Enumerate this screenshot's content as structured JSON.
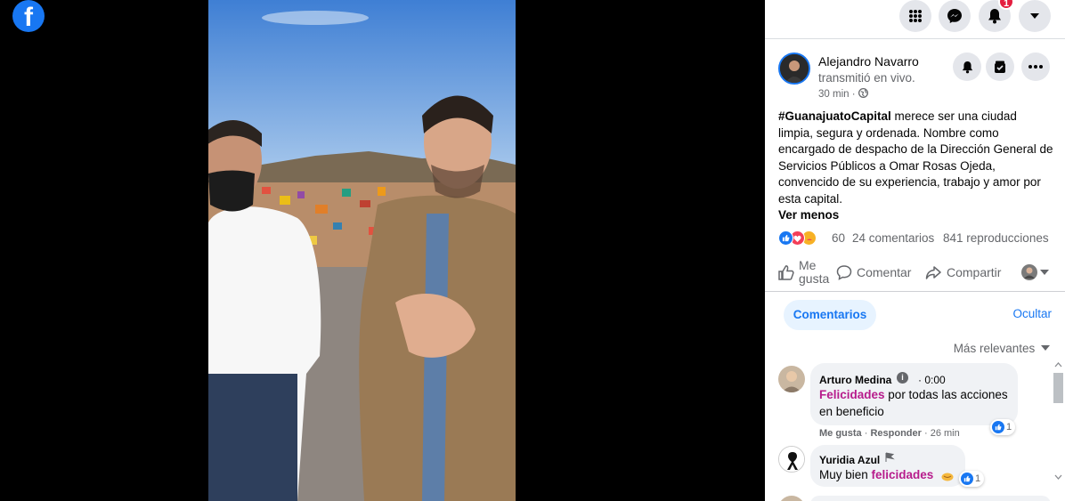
{
  "app": {
    "brand_logo": "f",
    "brand_color": "#1877f2"
  },
  "topnav": {
    "icons": [
      "menu-grid-icon",
      "messenger-icon",
      "bell-icon",
      "chevron-down-icon"
    ],
    "notification_count": "1"
  },
  "post": {
    "author": "Alejandro Navarro",
    "action": "transmitió en vivo.",
    "time": "30 min",
    "hashtag": "#GuanajuatoCapital",
    "text": " merece ser una ciudad limpia, segura y ordenada. Nombre como encargado de despacho de la Dirección General de Servicios Públicos a Omar Rosas Ojeda, convencido de su experiencia, trabajo y amor por esta capital.",
    "see_less": "Ver menos",
    "reaction_count": "60",
    "comment_count": "24 comentarios",
    "view_count": "841 reproducciones"
  },
  "actions": {
    "like": "Me gusta",
    "comment": "Comentar",
    "share": "Compartir"
  },
  "comments_section": {
    "tab": "Comentarios",
    "hide": "Ocultar",
    "sort": "Más relevantes"
  },
  "comments": [
    {
      "name": "Arturo Medina",
      "time": "0:00",
      "highlight": "Felicidades",
      "text": " por todas las acciones en beneficio",
      "meta_like": "Me gusta",
      "meta_reply": "Responder",
      "meta_time": "26 min",
      "likes": "1"
    },
    {
      "name": "Yuridia Azul",
      "text_pre": "Muy bien ",
      "highlight": "felicidades",
      "likes": "1"
    }
  ]
}
